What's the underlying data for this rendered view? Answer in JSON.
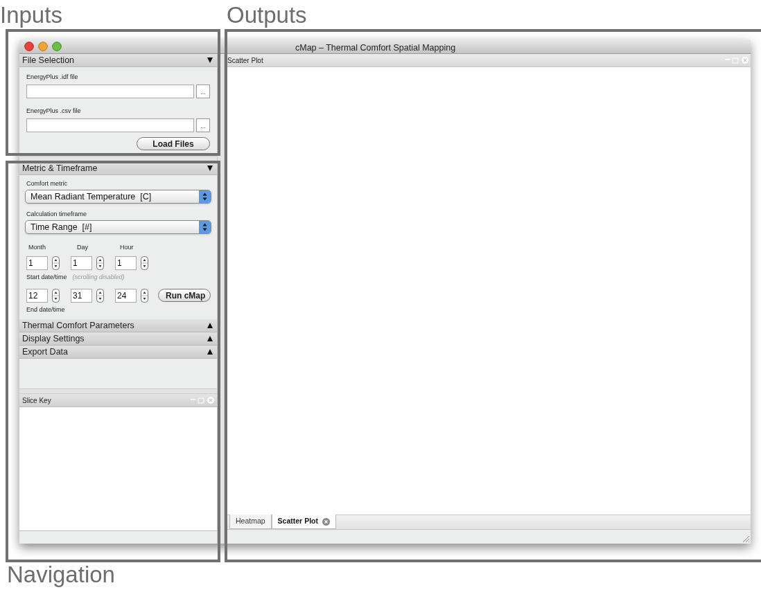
{
  "annotations": [
    {
      "label": "Inputs"
    },
    {
      "label": "Outputs"
    },
    {
      "label": "Navigation"
    }
  ],
  "window": {
    "title": "cMap – Thermal Comfort Spatial Mapping"
  },
  "file_selection": {
    "title": "File Selection",
    "expanded": true,
    "fields": [
      {
        "label": "EnergyPlus .idf file",
        "browse": "..."
      },
      {
        "label": "EnergyPlus .csv file",
        "browse": "..."
      }
    ],
    "button": "Load Files"
  },
  "metric_timeframe": {
    "title": "Metric & Timeframe",
    "expanded": true,
    "comfort_metric": {
      "label": "Comfort metric",
      "value": "Mean Radiant Temperature  [C]"
    },
    "timeframe": {
      "label": "Calculation timeframe",
      "value": "Time Range  [#]"
    },
    "column_labels": [
      "Month",
      "Day",
      "Hour"
    ],
    "start": {
      "values": [
        "1",
        "1",
        "1"
      ],
      "label": "Start date/time",
      "note": "(scrolling disabled)"
    },
    "end": {
      "values": [
        "12",
        "31",
        "24"
      ],
      "label": "End date/time"
    },
    "button": "Run cMap"
  },
  "collapsed_sections": [
    {
      "title": "Thermal Comfort Parameters",
      "expanded": false
    },
    {
      "title": "Display Settings",
      "expanded": false
    },
    {
      "title": "Export Data",
      "expanded": false
    }
  ],
  "slice_key": {
    "title": "Slice Key"
  },
  "output": {
    "title": "Scatter Plot",
    "tabs": [
      {
        "label": "Heatmap",
        "selected": false,
        "closable": false
      },
      {
        "label": "Scatter Plot",
        "selected": true,
        "closable": true
      }
    ]
  }
}
